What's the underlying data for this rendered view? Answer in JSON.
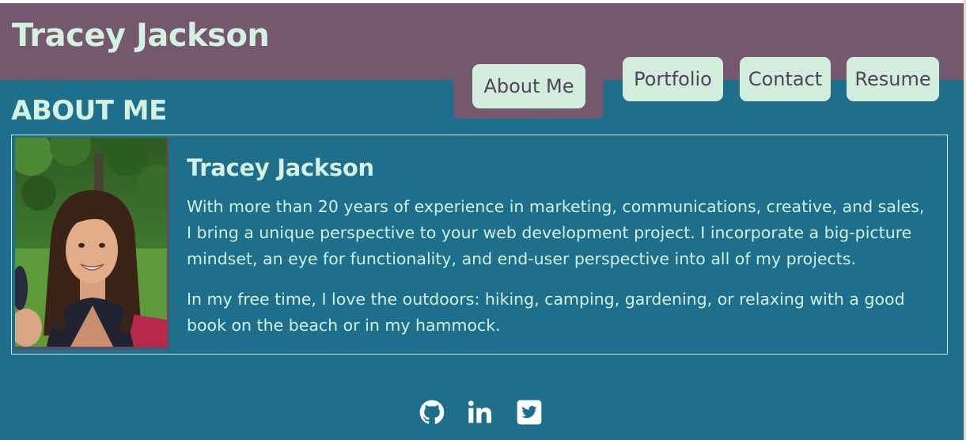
{
  "header": {
    "title": "Tracey Jackson"
  },
  "nav": {
    "items": [
      {
        "label": "About Me",
        "active": true
      },
      {
        "label": "Portfolio",
        "active": false
      },
      {
        "label": "Contact",
        "active": false
      },
      {
        "label": "Resume",
        "active": false
      }
    ]
  },
  "main": {
    "heading": "ABOUT ME",
    "card": {
      "name": "Tracey Jackson",
      "paragraphs": [
        "With more than 20 years of experience in marketing, communications, creative, and sales, I bring a unique perspective to your web development project. I incorporate a big-picture mindset, an eye for functionality, and end-user perspective into all of my projects.",
        "In my free time, I love the outdoors: hiking, camping, gardening, or relaxing with a good book on the beach or in my hammock."
      ]
    }
  },
  "footer": {
    "icons": [
      "github-icon",
      "linkedin-icon",
      "twitter-icon"
    ]
  },
  "colors": {
    "header_bg": "#73586e",
    "page_bg": "#1d6f8c",
    "text": "#d3f0e0",
    "button_bg": "#d3eddd",
    "button_text": "#4f4459"
  }
}
